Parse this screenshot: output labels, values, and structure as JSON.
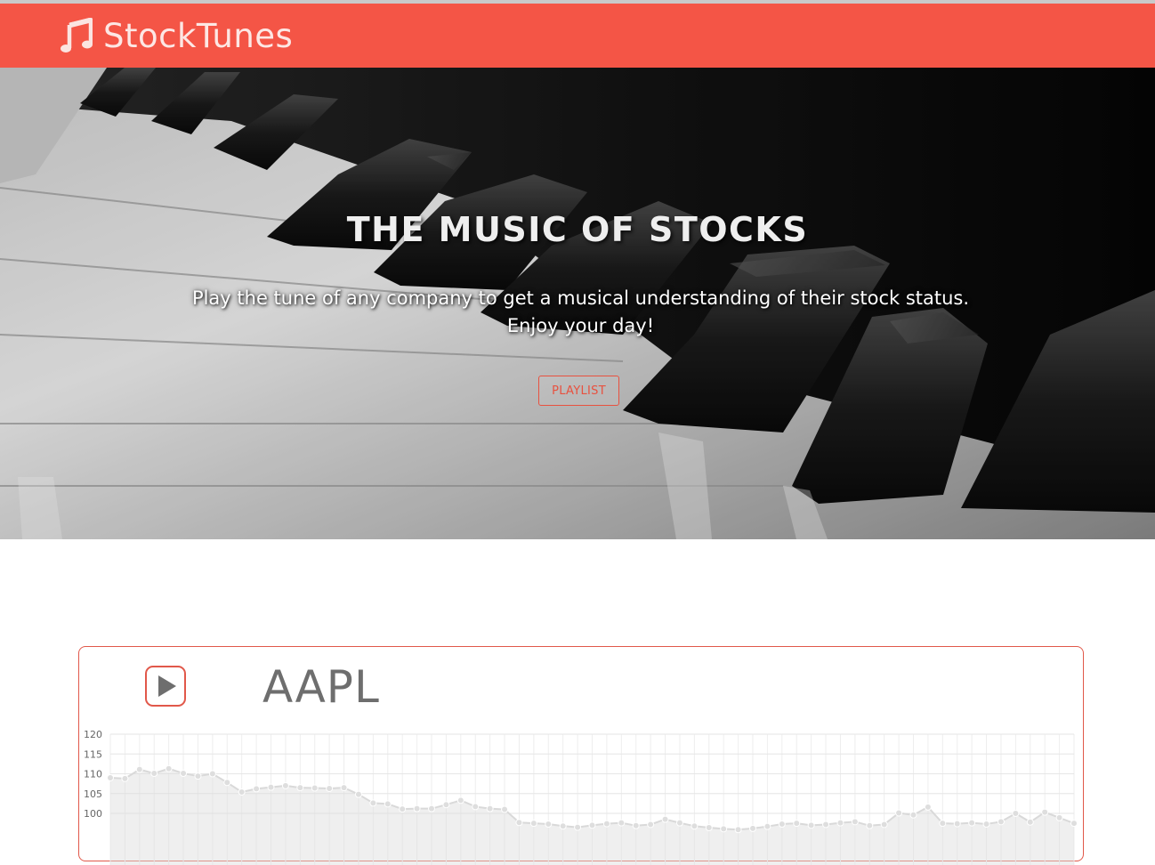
{
  "navbar": {
    "brand": "StockTunes",
    "brand_icon": "music-note-icon",
    "bg_color": "#f45546"
  },
  "hero": {
    "background": "piano-keys-photo",
    "title": "THE MUSIC OF STOCKS",
    "subtitle_line1": "Play the tune of any company to get a musical understanding of their stock status.",
    "subtitle_line2": "Enjoy your day!",
    "button_label": "PLAYLIST"
  },
  "stock_card": {
    "ticker": "AAPL",
    "play_icon": "play-icon",
    "accent_color": "#e1584a"
  },
  "chart_data": {
    "type": "area",
    "title": "",
    "xlabel": "",
    "ylabel": "",
    "ylim": [
      98,
      120
    ],
    "yticks": [
      100,
      105,
      110,
      115,
      120
    ],
    "grid": true,
    "series": [
      {
        "values": [
          109,
          108.8,
          111.1,
          110.1,
          111.3,
          110.1,
          109.4,
          110,
          107.8,
          105.4,
          106.2,
          106.6,
          107,
          106.5,
          106.4,
          106.3,
          106.5,
          104.8,
          102.6,
          102.4,
          101.1,
          101.2,
          101.2,
          102.2,
          103.3,
          101.7,
          101.2,
          101,
          97.7,
          97.5,
          97.3,
          96.8,
          96.5,
          97,
          97.4,
          97.6,
          96.9,
          97.2,
          98.5,
          97.6,
          96.8,
          96.4,
          96.1,
          95.9,
          96.2,
          96.7,
          97.3,
          97.5,
          97,
          97.2,
          97.6,
          97.9,
          96.9,
          97.2,
          100.1,
          99.6,
          101.6,
          97.5,
          97.4,
          97.6,
          97.3,
          97.9,
          100,
          97.8,
          100.3,
          98.9,
          97.5
        ]
      }
    ]
  }
}
